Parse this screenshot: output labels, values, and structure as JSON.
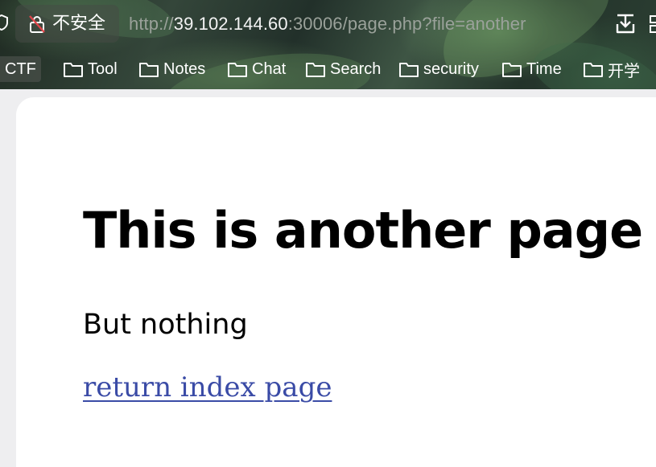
{
  "browser": {
    "security_label": "不安全",
    "url": {
      "scheme": "http://",
      "host": "39.102.144.60",
      "rest": ":30006/page.php?file=another"
    },
    "bookmarks": [
      {
        "label": "CTF",
        "icon": "folder-icon"
      },
      {
        "label": "Tool",
        "icon": "folder-icon"
      },
      {
        "label": "Notes",
        "icon": "folder-icon"
      },
      {
        "label": "Chat",
        "icon": "folder-icon"
      },
      {
        "label": "Search",
        "icon": "folder-icon"
      },
      {
        "label": "security",
        "icon": "folder-icon"
      },
      {
        "label": "Time",
        "icon": "folder-icon"
      },
      {
        "label": "开学",
        "icon": "folder-icon"
      }
    ],
    "colors": {
      "accent_link": "#3a4ba6",
      "page_background": "#ffffff"
    }
  },
  "page": {
    "heading": "This is another page",
    "body": "But nothing",
    "link_label": "return index page"
  }
}
